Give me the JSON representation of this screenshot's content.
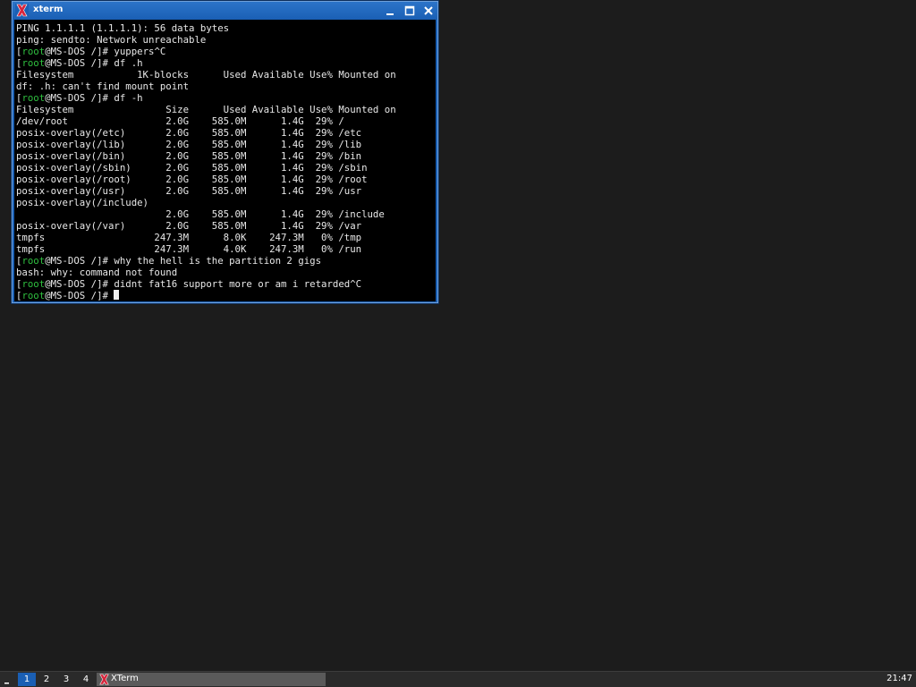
{
  "window": {
    "title": "xterm",
    "icon": "xterm-x-icon"
  },
  "terminal": {
    "lines": [
      [
        "PING 1.1.1.1 (1.1.1.1): 56 data bytes"
      ],
      [
        "ping: sendto: Network unreachable"
      ],
      [
        "[",
        "root",
        "@MS-DOS /]# yuppers^C"
      ],
      [
        "[",
        "root",
        "@MS-DOS /]# df .h"
      ],
      [
        "Filesystem           1K-blocks      Used Available Use% Mounted on"
      ],
      [
        "df: .h: can't find mount point"
      ],
      [
        "[",
        "root",
        "@MS-DOS /]# df -h"
      ],
      [
        "Filesystem                Size      Used Available Use% Mounted on"
      ],
      [
        "/dev/root                 2.0G    585.0M      1.4G  29% /"
      ],
      [
        "posix-overlay(/etc)       2.0G    585.0M      1.4G  29% /etc"
      ],
      [
        "posix-overlay(/lib)       2.0G    585.0M      1.4G  29% /lib"
      ],
      [
        "posix-overlay(/bin)       2.0G    585.0M      1.4G  29% /bin"
      ],
      [
        "posix-overlay(/sbin)      2.0G    585.0M      1.4G  29% /sbin"
      ],
      [
        "posix-overlay(/root)      2.0G    585.0M      1.4G  29% /root"
      ],
      [
        "posix-overlay(/usr)       2.0G    585.0M      1.4G  29% /usr"
      ],
      [
        "posix-overlay(/include)"
      ],
      [
        "                          2.0G    585.0M      1.4G  29% /include"
      ],
      [
        "posix-overlay(/var)       2.0G    585.0M      1.4G  29% /var"
      ],
      [
        "tmpfs                   247.3M      8.0K    247.3M   0% /tmp"
      ],
      [
        "tmpfs                   247.3M      4.0K    247.3M   0% /run"
      ],
      [
        "[",
        "root",
        "@MS-DOS /]# why the hell is the partition 2 gigs"
      ],
      [
        "bash: why: command not found"
      ],
      [
        "[",
        "root",
        "@MS-DOS /]# didnt fat16 support more or am i retarded^C"
      ],
      [
        "[",
        "root",
        "@MS-DOS /]# "
      ]
    ],
    "prompt_user_color": "#2fbf3f",
    "text_color": "#e8e8e8",
    "background": "#000000"
  },
  "taskbar": {
    "workspaces": [
      {
        "label": "1",
        "active": true
      },
      {
        "label": "2",
        "active": false
      },
      {
        "label": "3",
        "active": false
      },
      {
        "label": "4",
        "active": false
      }
    ],
    "task_label": "XTerm",
    "clock": "21:47"
  },
  "colors": {
    "titlebar": "#1a5fb4",
    "desktop": "#1c1c1c",
    "taskbar": "#2a2a2a"
  }
}
